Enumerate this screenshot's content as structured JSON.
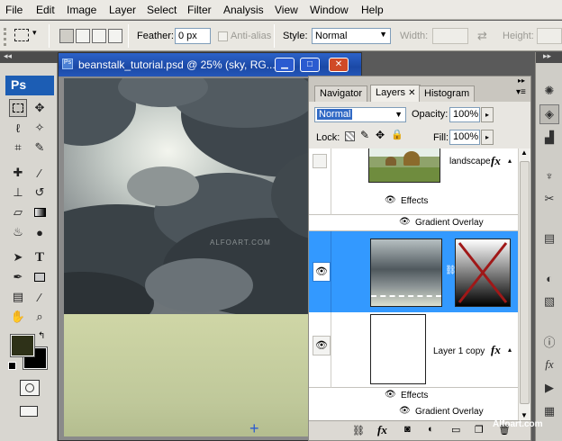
{
  "menu": {
    "items": [
      "File",
      "Edit",
      "Image",
      "Layer",
      "Select",
      "Filter",
      "Analysis",
      "View",
      "Window",
      "Help"
    ]
  },
  "options_bar": {
    "feather_label": "Feather:",
    "feather_value": "0 px",
    "antialias_label": "Anti-alias",
    "style_label": "Style:",
    "style_value": "Normal",
    "width_label": "Width:",
    "height_label": "Height:"
  },
  "toolbox": {
    "logo": "Ps"
  },
  "document": {
    "title": "beanstalk_tutorial.psd @ 25% (sky, RG...",
    "watermark_text": "ALFOART.COM"
  },
  "layers_panel": {
    "tabs": [
      "Navigator",
      "Layers",
      "Histogram"
    ],
    "active_tab": "Layers",
    "blend_mode": "Normal",
    "opacity_label": "Opacity:",
    "opacity_value": "100%",
    "lock_label": "Lock:",
    "fill_label": "Fill:",
    "fill_value": "100%",
    "layers": [
      {
        "name": "landscape",
        "effects_label": "Effects",
        "effect": "Gradient Overlay",
        "visible": false,
        "selected": false
      },
      {
        "name": "",
        "visible": true,
        "selected": true
      },
      {
        "name": "Layer 1 copy",
        "effects_label": "Effects",
        "effect": "Gradient Overlay",
        "visible": true,
        "selected": false
      }
    ],
    "fx_symbol": "fx",
    "selected_color": "#3399ff"
  },
  "site_watermark": "Alfoart.com"
}
